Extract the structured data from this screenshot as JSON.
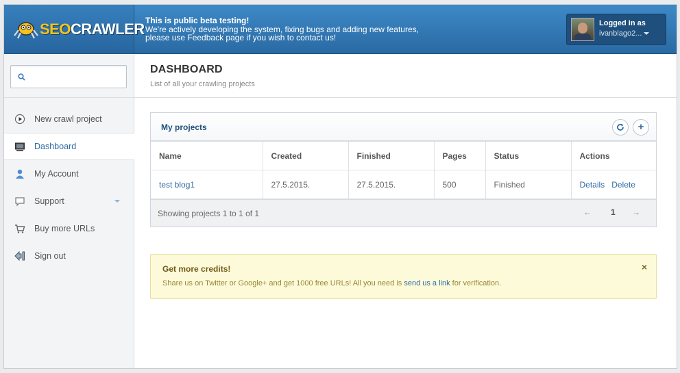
{
  "header": {
    "logo_seo": "SEO",
    "logo_crawler": "CRAWLER",
    "notice_title": "This is public beta testing!",
    "notice_line1": "We're actively developing the system, fixing bugs and adding new features,",
    "notice_line2": "please use Feedback page if you wish to contact us!",
    "logged_in_label": "Logged in as",
    "username": "ivanblago2..."
  },
  "sidebar": {
    "search": {
      "value": "",
      "placeholder": ""
    },
    "items": [
      {
        "label": "New crawl project",
        "icon": "play-icon"
      },
      {
        "label": "Dashboard",
        "icon": "monitor-icon",
        "active": true
      },
      {
        "label": "My Account",
        "icon": "user-icon"
      },
      {
        "label": "Support",
        "icon": "chat-icon",
        "has_dropdown": true
      },
      {
        "label": "Buy more URLs",
        "icon": "cart-icon"
      },
      {
        "label": "Sign out",
        "icon": "sign-out-icon"
      }
    ]
  },
  "page": {
    "title": "DASHBOARD",
    "subtitle": "List of all your crawling projects"
  },
  "projects": {
    "title": "My projects",
    "columns": [
      "Name",
      "Created",
      "Finished",
      "Pages",
      "Status",
      "Actions"
    ],
    "rows": [
      {
        "name": "test blog1",
        "created": "27.5.2015.",
        "finished": "27.5.2015.",
        "pages": "500",
        "status": "Finished",
        "details": "Details",
        "delete": "Delete"
      }
    ],
    "footer_text": "Showing projects 1 to 1 of 1",
    "pager": {
      "prev": "←",
      "page": "1",
      "next": "→"
    }
  },
  "alert": {
    "title": "Get more credits!",
    "text_before": "Share us on Twitter or Google+ and get 1000 free URLs! All you need is ",
    "link": "send us a link",
    "text_after": " for verification.",
    "close": "×"
  },
  "colors": {
    "accent": "#2e6aa3",
    "header": "#3d89c7",
    "alert_bg": "#fdfad9"
  }
}
